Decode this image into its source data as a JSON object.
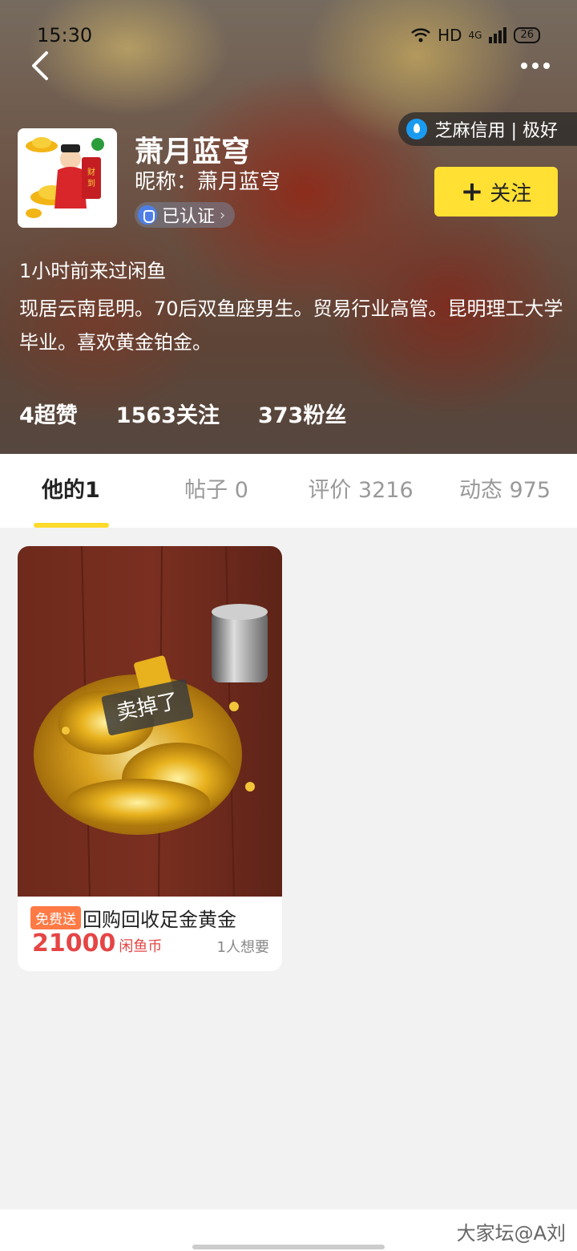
{
  "status_bar": {
    "time": "15:30",
    "network": "HD",
    "signal": "4G",
    "battery": "26"
  },
  "profile": {
    "name": "萧月蓝穹",
    "nickname": "昵称：萧月蓝穹",
    "verified_label": "已认证",
    "credit_label": "芝麻信用 | 极好",
    "follow_label": "关注",
    "last_seen": "1小时前来过闲鱼",
    "bio": "现居云南昆明。70后双鱼座男生。贸易行业高管。昆明理工大学毕业。喜欢黄金铂金。",
    "stats": {
      "likes": "4超赞",
      "following": "1563关注",
      "fans": "373粉丝"
    }
  },
  "tabs": [
    {
      "label": "他的1"
    },
    {
      "label": "帖子 0"
    },
    {
      "label": "评价 3216"
    },
    {
      "label": "动态 975"
    }
  ],
  "item": {
    "sold_tag": "卖掉了",
    "badge": "免费送",
    "title": "回购回收足金黄金",
    "price": "21000",
    "price_unit": "闲鱼币",
    "wants": "1人想要"
  },
  "watermark": "大家坛@A刘",
  "colors": {
    "accent": "#ffda2b",
    "price": "#e54545",
    "follow_bg": "#ffe033",
    "badge": "#ff7a45"
  }
}
